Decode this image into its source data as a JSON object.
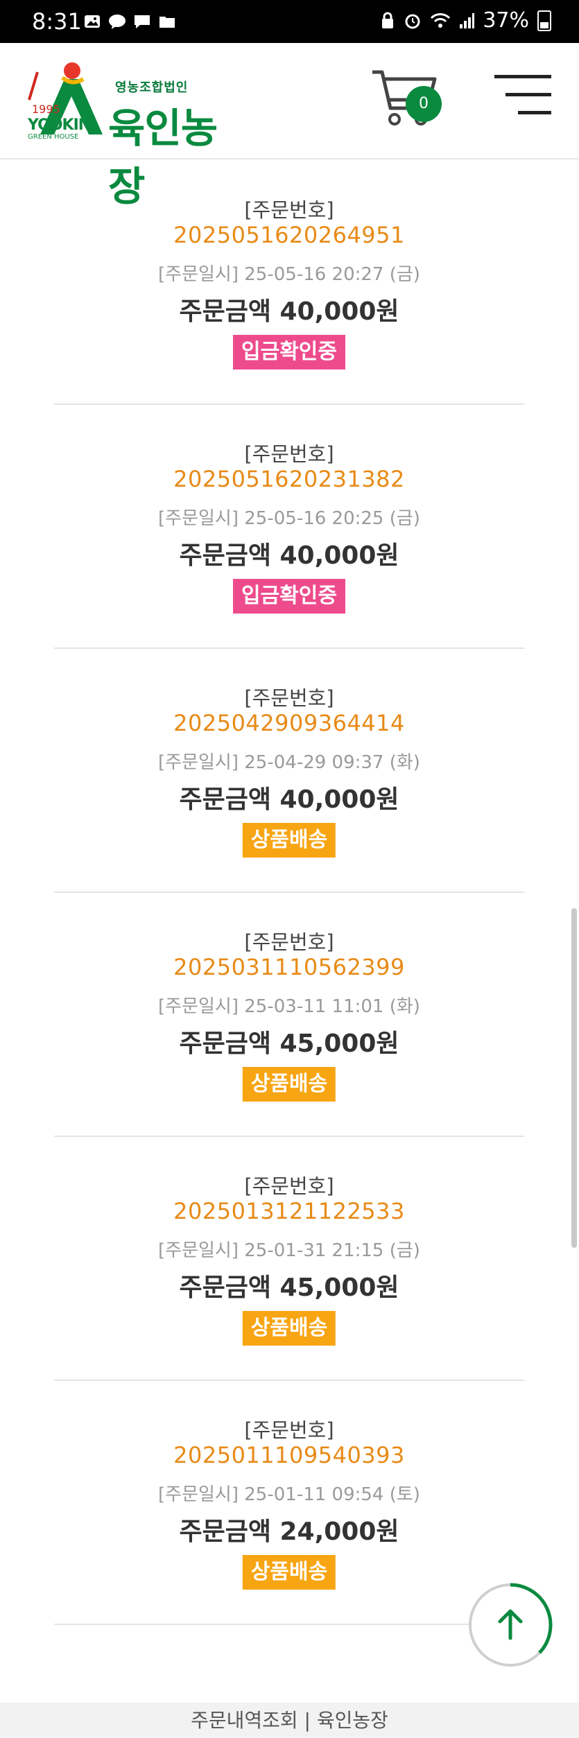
{
  "status_bar": {
    "time": "8:31",
    "battery": "37%"
  },
  "header": {
    "logo_sub": "영농조합법인",
    "logo_main": "육인농장",
    "logo_year": "1995",
    "logo_en": "YOOKIN",
    "logo_en_sub": "GREEN HOUSE",
    "cart_count": "0"
  },
  "orders": [
    {
      "label": "[주문번호]",
      "number": "2025051620264951",
      "date": "[주문일시] 25-05-16 20:27 (금)",
      "amount": "주문금액 40,000원",
      "status": "입금확인중"
    },
    {
      "label": "[주문번호]",
      "number": "2025051620231382",
      "date": "[주문일시] 25-05-16 20:25 (금)",
      "amount": "주문금액 40,000원",
      "status": "입금확인중"
    },
    {
      "label": "[주문번호]",
      "number": "2025042909364414",
      "date": "[주문일시] 25-04-29 09:37 (화)",
      "amount": "주문금액 40,000원",
      "status": "상품배송"
    },
    {
      "label": "[주문번호]",
      "number": "2025031110562399",
      "date": "[주문일시] 25-03-11 11:01 (화)",
      "amount": "주문금액 45,000원",
      "status": "상품배송"
    },
    {
      "label": "[주문번호]",
      "number": "2025013121122533",
      "date": "[주문일시] 25-01-31 21:15 (금)",
      "amount": "주문금액 45,000원",
      "status": "상품배송"
    },
    {
      "label": "[주문번호]",
      "number": "2025011109540393",
      "date": "[주문일시] 25-01-11 09:54 (토)",
      "amount": "주문금액 24,000원",
      "status": "상품배송"
    }
  ],
  "footer": {
    "text": "주문내역조회 | 육인농장"
  },
  "colors": {
    "brand_green": "#0a8a3f",
    "order_number": "#e88a16",
    "badge_pending": "#ee4b8d",
    "badge_shipping": "#f8a514"
  },
  "icons": {
    "cart": "cart-icon",
    "menu": "hamburger-menu-icon",
    "top": "arrow-up-icon"
  }
}
